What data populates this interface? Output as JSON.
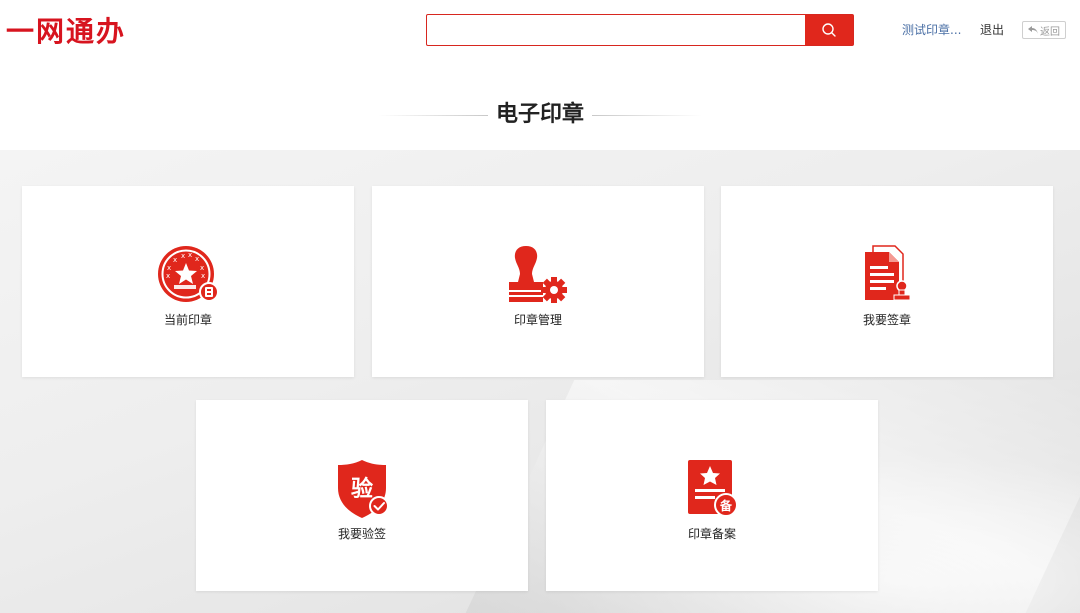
{
  "header": {
    "logo": "一网通办",
    "search": {
      "value": "",
      "placeholder": ""
    },
    "user_link": "测试印章...",
    "logout": "退出",
    "back": "返回"
  },
  "section": {
    "title": "电子印章"
  },
  "cards": [
    {
      "label": "当前印章",
      "icon": "seal-icon"
    },
    {
      "label": "印章管理",
      "icon": "stamp-gear-icon"
    },
    {
      "label": "我要签章",
      "icon": "document-stamp-icon"
    },
    {
      "label": "我要验签",
      "icon": "verify-shield-icon"
    },
    {
      "label": "印章备案",
      "icon": "filing-icon"
    }
  ],
  "colors": {
    "accent": "#e0271c",
    "link": "#4a6fa5"
  }
}
